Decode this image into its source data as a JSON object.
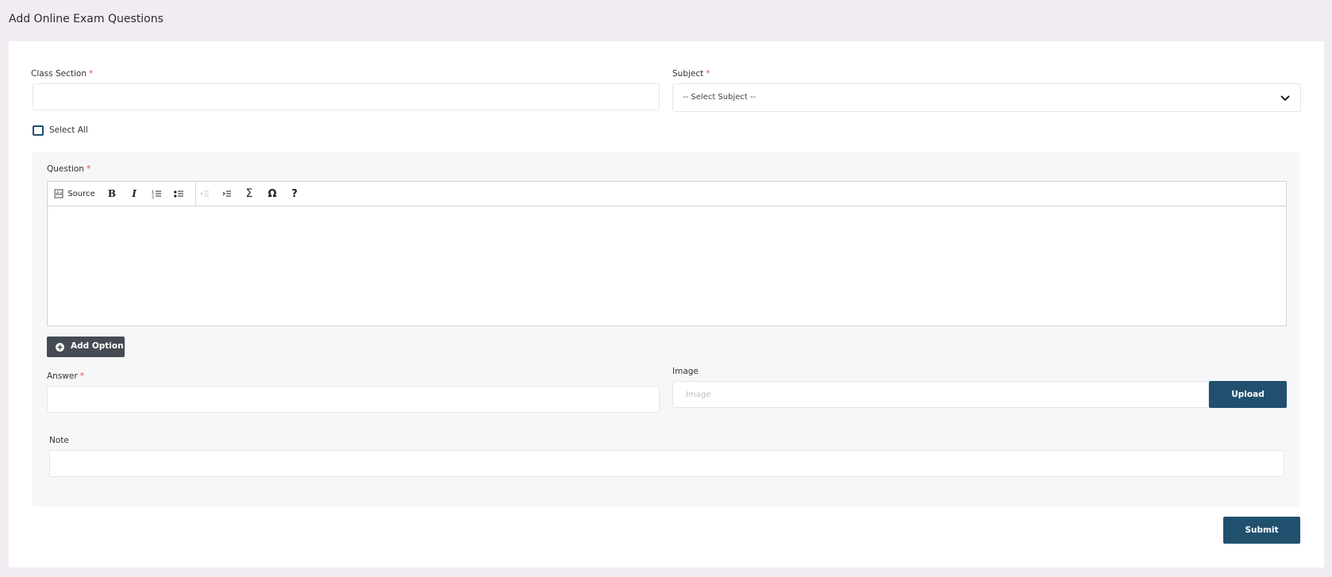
{
  "page": {
    "title": "Add Online Exam Questions"
  },
  "form": {
    "class_section": {
      "label": "Class Section",
      "required_mark": "*",
      "value": ""
    },
    "subject": {
      "label": "Subject",
      "required_mark": "*",
      "selected": "-- Select Subject --"
    },
    "select_all": {
      "label": "Select All",
      "checked": false
    },
    "question": {
      "label": "Question",
      "required_mark": "*",
      "toolbar": {
        "source_label": "Source",
        "buttons": [
          "source-icon",
          "bold-icon",
          "italic-icon",
          "numbered-list-icon",
          "bulleted-list-icon",
          "outdent-icon",
          "indent-icon",
          "sigma-icon",
          "omega-icon",
          "help-icon"
        ]
      },
      "content": ""
    },
    "add_option_label": "Add Option",
    "answer": {
      "label": "Answer",
      "required_mark": "*",
      "value": ""
    },
    "image": {
      "label": "Image",
      "placeholder": "Image",
      "upload_label": "Upload"
    },
    "note": {
      "label": "Note",
      "value": ""
    },
    "submit_label": "Submit"
  },
  "colors": {
    "background": "#f1ecf2",
    "primary_button": "#21506f",
    "secondary_button": "#454b52",
    "required": "#e0524f"
  }
}
